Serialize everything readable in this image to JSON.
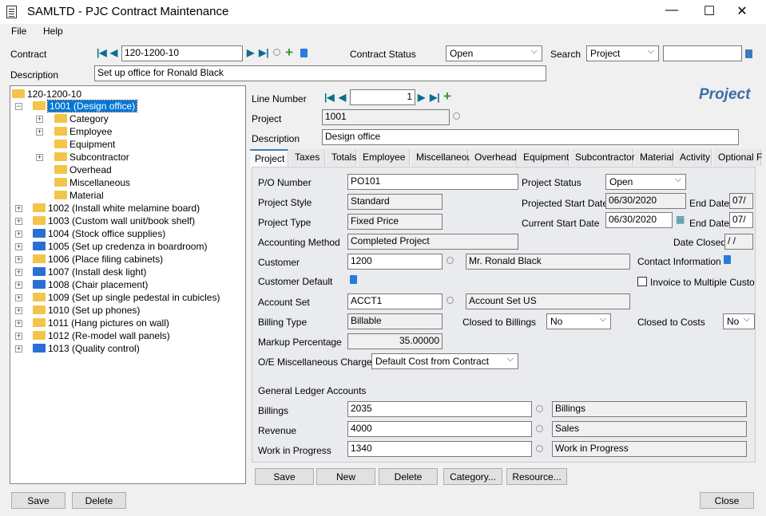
{
  "window": {
    "title": "SAMLTD - PJC Contract Maintenance",
    "minimize": "—",
    "maximize": "☐",
    "close": "✕"
  },
  "menu": [
    "File",
    "Help"
  ],
  "header": {
    "contract_label": "Contract",
    "contract_value": "120-1200-10",
    "status_label": "Contract Status",
    "status_value": "Open",
    "search_label": "Search",
    "search_field": "Project",
    "search_value": "",
    "description_label": "Description",
    "description_value": "Set up office for Ronald Black"
  },
  "tree": {
    "root": "120-1200-10",
    "selected": "1001 (Design office)",
    "children_of_selected": [
      "Category",
      "Employee",
      "Equipment",
      "Subcontractor",
      "Overhead",
      "Miscellaneous",
      "Material"
    ],
    "items": [
      {
        "label": "1002 (Install white melamine board)",
        "color": "yellow"
      },
      {
        "label": "1003 (Custom wall unit/book shelf)",
        "color": "yellow"
      },
      {
        "label": "1004 (Stock office supplies)",
        "color": "blue"
      },
      {
        "label": "1005 (Set up credenza in boardroom)",
        "color": "blue"
      },
      {
        "label": "1006 (Place filing cabinets)",
        "color": "yellow"
      },
      {
        "label": "1007 (Install desk light)",
        "color": "blue"
      },
      {
        "label": "1008 (Chair placement)",
        "color": "blue"
      },
      {
        "label": "1009 (Set up single pedestal in cubicles)",
        "color": "yellow"
      },
      {
        "label": "1010 (Set up phones)",
        "color": "yellow"
      },
      {
        "label": "1011 (Hang pictures on wall)",
        "color": "yellow"
      },
      {
        "label": "1012 (Re-model wall panels)",
        "color": "yellow"
      },
      {
        "label": "1013 (Quality control)",
        "color": "blue"
      }
    ]
  },
  "detail": {
    "line_number_label": "Line Number",
    "line_number": "1",
    "heading": "Project",
    "project_label": "Project",
    "project_value": "1001",
    "description_label": "Description",
    "description_value": "Design office"
  },
  "tabs": [
    "Project",
    "Taxes",
    "Totals",
    "Employee",
    "Miscellaneous",
    "Overhead",
    "Equipment",
    "Subcontractor",
    "Material",
    "Activity",
    "Optional F"
  ],
  "form": {
    "po_label": "P/O Number",
    "po": "PO101",
    "project_status_label": "Project Status",
    "project_status": "Open",
    "style_label": "Project Style",
    "style": "Standard",
    "proj_start_label": "Projected Start Date",
    "proj_start": "06/30/2020",
    "end_label": "End Date",
    "proj_end": "07/",
    "type_label": "Project Type",
    "type": "Fixed Price",
    "cur_start_label": "Current Start Date",
    "cur_start": "06/30/2020",
    "cur_end": "07/",
    "accounting_label": "Accounting Method",
    "accounting": "Completed Project",
    "date_closed_label": "Date Closed",
    "date_closed": "/  /",
    "customer_label": "Customer",
    "customer": "1200",
    "customer_name": "Mr. Ronald Black",
    "contact_label": "Contact Information",
    "customer_default_label": "Customer Default",
    "invoice_multi_label": "Invoice to Multiple Custon",
    "account_set_label": "Account Set",
    "account_set": "ACCT1",
    "account_set_desc": "Account Set US",
    "billing_type_label": "Billing Type",
    "billing_type": "Billable",
    "closed_billings_label": "Closed to Billings",
    "closed_billings": "No",
    "closed_costs_label": "Closed to Costs",
    "closed_costs": "No",
    "markup_label": "Markup Percentage",
    "markup": "35.00000",
    "oe_label": "O/E Miscellaneous Charges",
    "oe": "Default Cost from Contract",
    "gl_label": "General Ledger Accounts",
    "billings_label": "Billings",
    "billings": "2035",
    "billings_desc": "Billings",
    "revenue_label": "Revenue",
    "revenue": "4000",
    "revenue_desc": "Sales",
    "wip_label": "Work in Progress",
    "wip": "1340",
    "wip_desc": "Work in Progress"
  },
  "detail_buttons": [
    "Save",
    "New",
    "Delete",
    "Category...",
    "Resource..."
  ],
  "footer": {
    "save": "Save",
    "delete": "Delete",
    "close": "Close"
  }
}
